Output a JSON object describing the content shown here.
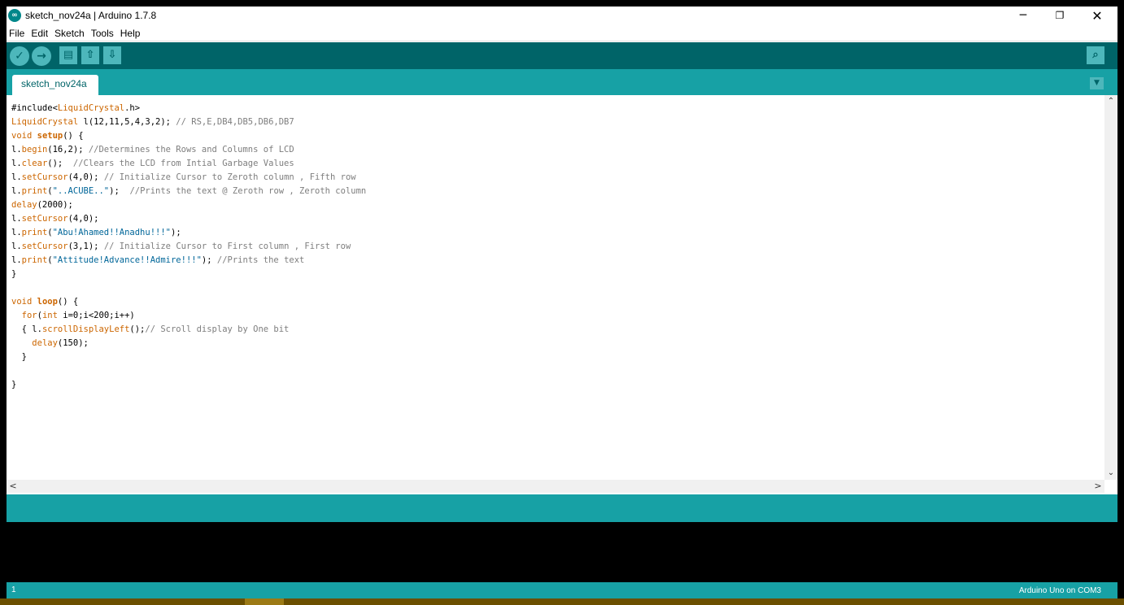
{
  "window": {
    "title": "sketch_nov24a | Arduino 1.7.8",
    "app_icon": "arduino-logo-icon"
  },
  "window_controls": {
    "minimize": "─",
    "maximize": "❐",
    "close": "✕"
  },
  "menu": {
    "items": [
      "File",
      "Edit",
      "Sketch",
      "Tools",
      "Help"
    ]
  },
  "toolbar": {
    "verify_icon": "✓",
    "upload_icon": "→",
    "new_icon": "▤",
    "open_icon": "⇧",
    "save_icon": "⇩",
    "serial_monitor_icon": "⌕"
  },
  "tabs": [
    {
      "label": "sketch_nov24a"
    }
  ],
  "tab_menu_icon": "▼",
  "code": {
    "lines": [
      [
        {
          "t": "#include<",
          "c": ""
        },
        {
          "t": "LiquidCrystal",
          "c": "ty"
        },
        {
          "t": ".h>",
          "c": ""
        }
      ],
      [
        {
          "t": "LiquidCrystal",
          "c": "ty"
        },
        {
          "t": " l(12,11,5,4,3,2); ",
          "c": ""
        },
        {
          "t": "// RS,E,DB4,DB5,DB6,DB7",
          "c": "cm"
        }
      ],
      [
        {
          "t": "void",
          "c": "kw"
        },
        {
          "t": " ",
          "c": ""
        },
        {
          "t": "setup",
          "c": "fnb"
        },
        {
          "t": "() {",
          "c": ""
        }
      ],
      [
        {
          "t": "l.",
          "c": ""
        },
        {
          "t": "begin",
          "c": "fn"
        },
        {
          "t": "(16,2); ",
          "c": ""
        },
        {
          "t": "//Determines the Rows and Columns of LCD",
          "c": "cm"
        }
      ],
      [
        {
          "t": "l.",
          "c": ""
        },
        {
          "t": "clear",
          "c": "fn"
        },
        {
          "t": "();  ",
          "c": ""
        },
        {
          "t": "//Clears the LCD from Intial Garbage Values",
          "c": "cm"
        }
      ],
      [
        {
          "t": "l.",
          "c": ""
        },
        {
          "t": "setCursor",
          "c": "fn"
        },
        {
          "t": "(4,0); ",
          "c": ""
        },
        {
          "t": "// Initialize Cursor to Zeroth column , Fifth row",
          "c": "cm"
        }
      ],
      [
        {
          "t": "l.",
          "c": ""
        },
        {
          "t": "print",
          "c": "fn"
        },
        {
          "t": "(",
          "c": ""
        },
        {
          "t": "\"..ACUBE..\"",
          "c": "st"
        },
        {
          "t": ");  ",
          "c": ""
        },
        {
          "t": "//Prints the text @ Zeroth row , Zeroth column",
          "c": "cm"
        }
      ],
      [
        {
          "t": "delay",
          "c": "fn"
        },
        {
          "t": "(2000);",
          "c": ""
        }
      ],
      [
        {
          "t": "l.",
          "c": ""
        },
        {
          "t": "setCursor",
          "c": "fn"
        },
        {
          "t": "(4,0);",
          "c": ""
        }
      ],
      [
        {
          "t": "l.",
          "c": ""
        },
        {
          "t": "print",
          "c": "fn"
        },
        {
          "t": "(",
          "c": ""
        },
        {
          "t": "\"Abu!Ahamed!!Anadhu!!!\"",
          "c": "st"
        },
        {
          "t": ");",
          "c": ""
        }
      ],
      [
        {
          "t": "l.",
          "c": ""
        },
        {
          "t": "setCursor",
          "c": "fn"
        },
        {
          "t": "(3,1); ",
          "c": ""
        },
        {
          "t": "// Initialize Cursor to First column , First row",
          "c": "cm"
        }
      ],
      [
        {
          "t": "l.",
          "c": ""
        },
        {
          "t": "print",
          "c": "fn"
        },
        {
          "t": "(",
          "c": ""
        },
        {
          "t": "\"Attitude!Advance!!Admire!!!\"",
          "c": "st"
        },
        {
          "t": "); ",
          "c": ""
        },
        {
          "t": "//Prints the text",
          "c": "cm"
        }
      ],
      [
        {
          "t": "}",
          "c": ""
        }
      ],
      [
        {
          "t": "",
          "c": ""
        }
      ],
      [
        {
          "t": "void",
          "c": "kw"
        },
        {
          "t": " ",
          "c": ""
        },
        {
          "t": "loop",
          "c": "fnb"
        },
        {
          "t": "() {",
          "c": ""
        }
      ],
      [
        {
          "t": "  ",
          "c": ""
        },
        {
          "t": "for",
          "c": "kw"
        },
        {
          "t": "(",
          "c": ""
        },
        {
          "t": "int",
          "c": "kw"
        },
        {
          "t": " i=0;i<200;i++)",
          "c": ""
        }
      ],
      [
        {
          "t": "  { l.",
          "c": ""
        },
        {
          "t": "scrollDisplayLeft",
          "c": "fn"
        },
        {
          "t": "();",
          "c": ""
        },
        {
          "t": "// Scroll display by One bit",
          "c": "cm"
        }
      ],
      [
        {
          "t": "    ",
          "c": ""
        },
        {
          "t": "delay",
          "c": "fn"
        },
        {
          "t": "(150);",
          "c": ""
        }
      ],
      [
        {
          "t": "  }",
          "c": ""
        }
      ],
      [
        {
          "t": "",
          "c": ""
        }
      ],
      [
        {
          "t": "}",
          "c": ""
        }
      ]
    ]
  },
  "scrollbars": {
    "up": "⌃",
    "down": "⌄",
    "left": "<",
    "right": ">"
  },
  "status": {
    "line_number": "1",
    "board": "Arduino Uno on COM3"
  },
  "colors": {
    "toolbar": "#006468",
    "tabbar": "#17a1a5",
    "button": "#4db7bb"
  }
}
